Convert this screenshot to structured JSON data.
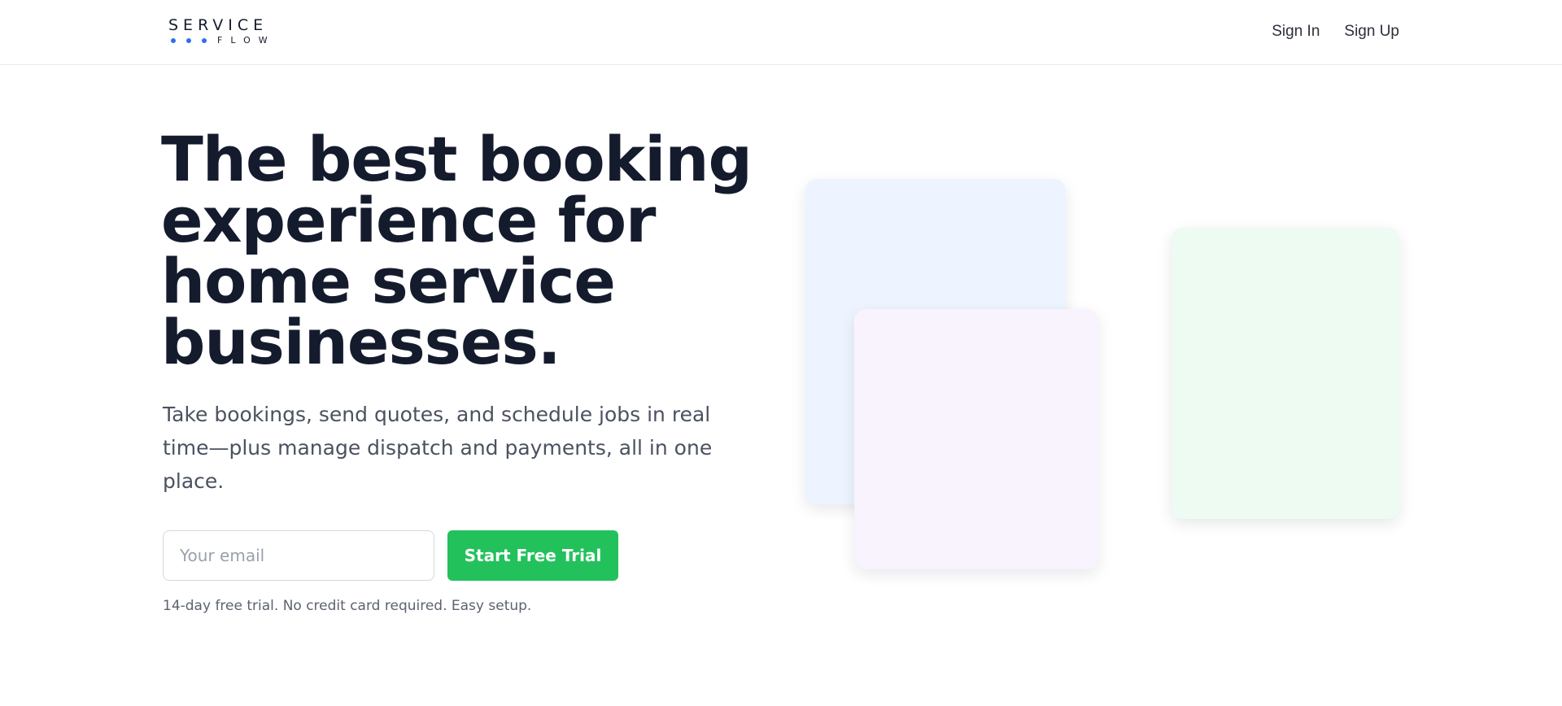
{
  "header": {
    "logo": {
      "word_top": "SERVICE",
      "word_bottom": "FLOW",
      "dot_color": "#2f6ff0"
    },
    "nav": {
      "sign_in": "Sign In",
      "sign_up": "Sign Up"
    }
  },
  "hero": {
    "title": "The best booking experience for home service businesses.",
    "subtitle": "Take bookings, send quotes, and schedule jobs in real time—plus manage dispatch and payments, all in one place.",
    "email_placeholder": "Your email",
    "cta_label": "Start Free Trial",
    "fineprint": "14-day free trial. No credit card required. Easy setup."
  },
  "colors": {
    "accent": "#23c15c",
    "heading": "#141b2d",
    "card_blue": "#edf4ff",
    "card_pink": "#f8f3fd",
    "card_green": "#eefbf2"
  }
}
